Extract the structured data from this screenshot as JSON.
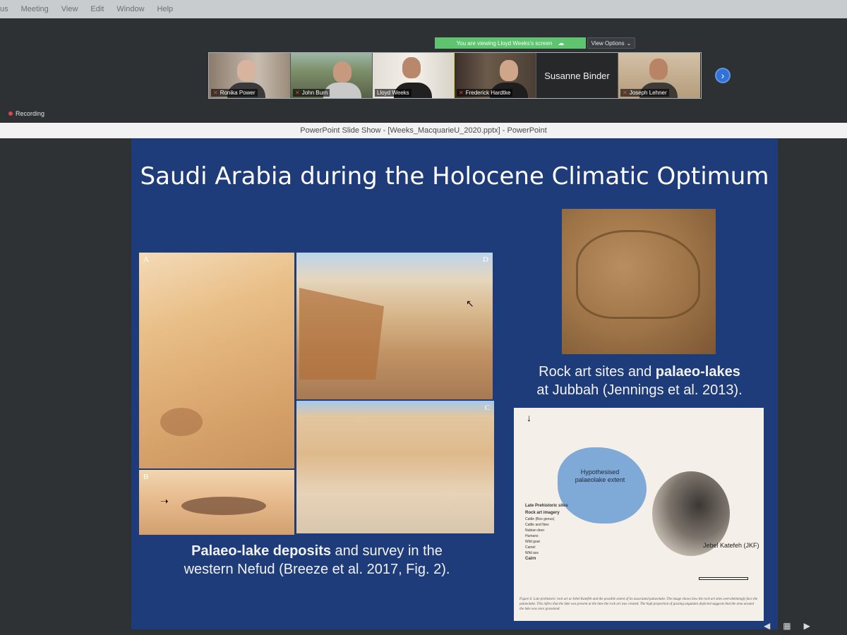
{
  "menubar": {
    "items": [
      "us",
      "Meeting",
      "View",
      "Edit",
      "Window",
      "Help"
    ]
  },
  "zoom": {
    "share_banner": "You are viewing Lloyd Weeks's screen",
    "view_options": "View Options",
    "recording": "Recording",
    "participants": [
      {
        "name": "Ronika Power"
      },
      {
        "name": "John Burn"
      },
      {
        "name": "Lloyd Weeks"
      },
      {
        "name": "Frederick Hardtke"
      },
      {
        "name": "Susanne Binder"
      },
      {
        "name": "Joseph Lehner"
      }
    ]
  },
  "powerpoint": {
    "window_title": "PowerPoint Slide Show - [Weeks_MacquarieU_2020.pptx] - PowerPoint"
  },
  "slide": {
    "title": "Saudi Arabia during the Holocene Climatic Optimum",
    "collage_letters": {
      "a": "A",
      "b": "B",
      "c": "C",
      "d": "D"
    },
    "caption_left_bold": "Palaeo-lake deposits",
    "caption_left_rest_1": " and survey in the",
    "caption_left_rest_2": "western Nefud (Breeze et al. 2017, Fig. 2).",
    "caption_right_1": "Rock art sites and ",
    "caption_right_bold": "palaeo-lakes",
    "caption_right_2": "at Jubbah (Jennings et al. 2013).",
    "map": {
      "lake_label": "Hypothesised palaeolake extent",
      "mountain_label": "Jebel Katefeh (JKF)",
      "legend_title": "Late Prehistoric sites",
      "legend_subtitle": "Rock art imagery",
      "legend_items": [
        "Cattle (Bos genus)",
        "Cattle and Ibex",
        "Nubian deer",
        "Humans",
        "Wild goat",
        "Camel",
        "Wild ass"
      ],
      "legend_cairn": "Cairn",
      "figure_caption": "Figure 6. Late prehistoric rock art at Jebel Katefeh and the possible extent of its associated palaeolake. The image shows how the rock art sites overwhelmingly face the palaeolake. This infers that the lake was present at the time the rock art was created. The high proportion of grazing ungulates depicted suggests that the area around the lake was once grassland."
    }
  },
  "colors": {
    "slide_bg": "#1e3c7a",
    "banner": "#5fc46f",
    "next_button": "#2f73d8",
    "recording_dot": "#e24444"
  }
}
